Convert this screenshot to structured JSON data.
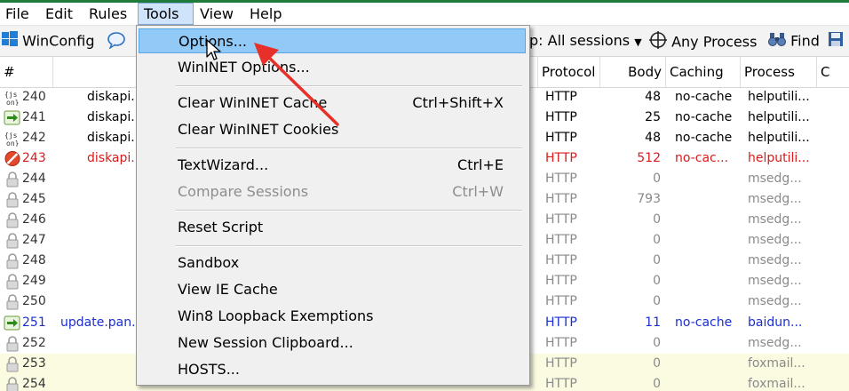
{
  "menubar": {
    "items": [
      "File",
      "Edit",
      "Rules",
      "Tools",
      "View",
      "Help"
    ]
  },
  "toolbar": {
    "winconfig": "WinConfig",
    "sessions": "p: All sessions",
    "any_process": "Any Process",
    "find": "Find"
  },
  "columns": {
    "num": "#",
    "protocol": "Protocol",
    "body": "Body",
    "caching": "Caching",
    "process": "Process",
    "extra": "C"
  },
  "rows": [
    {
      "num": "240",
      "host": "diskapi.b",
      "protocol": "HTTP",
      "body": "48",
      "caching": "no-cache",
      "process": "helputili...",
      "color": "black",
      "icon": "json"
    },
    {
      "num": "241",
      "host": "diskapi.b",
      "protocol": "HTTP",
      "body": "25",
      "caching": "no-cache",
      "process": "helputili...",
      "color": "black",
      "icon": "arrow"
    },
    {
      "num": "242",
      "host": "diskapi.b",
      "protocol": "HTTP",
      "body": "48",
      "caching": "no-cache",
      "process": "helputili...",
      "color": "black",
      "icon": "json"
    },
    {
      "num": "243",
      "host": "diskapi.b",
      "protocol": "HTTP",
      "body": "512",
      "caching": "no-cac...",
      "process": "helputili...",
      "color": "red",
      "icon": "blocked"
    },
    {
      "num": "244",
      "host": "",
      "protocol": "HTTP",
      "body": "0",
      "caching": "",
      "process": "msedg...",
      "color": "gray",
      "icon": "lock"
    },
    {
      "num": "245",
      "host": "",
      "protocol": "HTTP",
      "body": "793",
      "caching": "",
      "process": "msedg...",
      "color": "gray",
      "icon": "lock"
    },
    {
      "num": "246",
      "host": "",
      "protocol": "HTTP",
      "body": "0",
      "caching": "",
      "process": "msedg...",
      "color": "gray",
      "icon": "lock"
    },
    {
      "num": "247",
      "host": "",
      "protocol": "HTTP",
      "body": "0",
      "caching": "",
      "process": "msedg...",
      "color": "gray",
      "icon": "lock"
    },
    {
      "num": "248",
      "host": "",
      "protocol": "HTTP",
      "body": "0",
      "caching": "",
      "process": "msedg...",
      "color": "gray",
      "icon": "lock"
    },
    {
      "num": "249",
      "host": "",
      "protocol": "HTTP",
      "body": "0",
      "caching": "",
      "process": "msedg...",
      "color": "gray",
      "icon": "lock"
    },
    {
      "num": "250",
      "host": "",
      "protocol": "HTTP",
      "body": "0",
      "caching": "",
      "process": "msedg...",
      "color": "gray",
      "icon": "lock"
    },
    {
      "num": "251",
      "host": "update.pan.b",
      "protocol": "HTTP",
      "body": "11",
      "caching": "no-cache",
      "process": "baidun...",
      "color": "blue",
      "icon": "arrow"
    },
    {
      "num": "252",
      "host": "",
      "protocol": "HTTP",
      "body": "0",
      "caching": "",
      "process": "msedg...",
      "color": "gray",
      "icon": "lock"
    },
    {
      "num": "253",
      "host": "",
      "protocol": "HTTP",
      "body": "0",
      "caching": "",
      "process": "foxmail...",
      "color": "gray",
      "icon": "lock",
      "highlight": true
    },
    {
      "num": "254",
      "host": "",
      "protocol": "HTTP",
      "body": "0",
      "caching": "",
      "process": "foxmail...",
      "color": "gray",
      "icon": "lock",
      "highlight": true
    }
  ],
  "tools_menu": {
    "items": [
      {
        "label": "Options...",
        "shortcut": "",
        "selected": true
      },
      {
        "label": "WinINET Options...",
        "shortcut": ""
      },
      {
        "label": "Clear WinINET Cache",
        "shortcut": "Ctrl+Shift+X"
      },
      {
        "label": "Clear WinINET Cookies",
        "shortcut": ""
      },
      {
        "label": "TextWizard...",
        "shortcut": "Ctrl+E"
      },
      {
        "label": "Compare Sessions",
        "shortcut": "Ctrl+W",
        "disabled": true
      },
      {
        "label": "Reset Script",
        "shortcut": ""
      },
      {
        "label": "Sandbox",
        "shortcut": ""
      },
      {
        "label": "View IE Cache",
        "shortcut": ""
      },
      {
        "label": "Win8 Loopback Exemptions",
        "shortcut": ""
      },
      {
        "label": "New Session Clipboard...",
        "shortcut": ""
      },
      {
        "label": "HOSTS...",
        "shortcut": ""
      }
    ]
  },
  "colors": {
    "red": "#d81c1c",
    "blue": "#1a2fd0",
    "gray": "#8a8a8a",
    "selection": "#91c9f7",
    "annotation_arrow": "#e8302a"
  },
  "icons": {
    "windows": "windows-logo-icon",
    "speech": "speech-bubble-icon",
    "target": "crosshair-icon",
    "binoculars": "binoculars-icon",
    "save": "save-icon"
  }
}
